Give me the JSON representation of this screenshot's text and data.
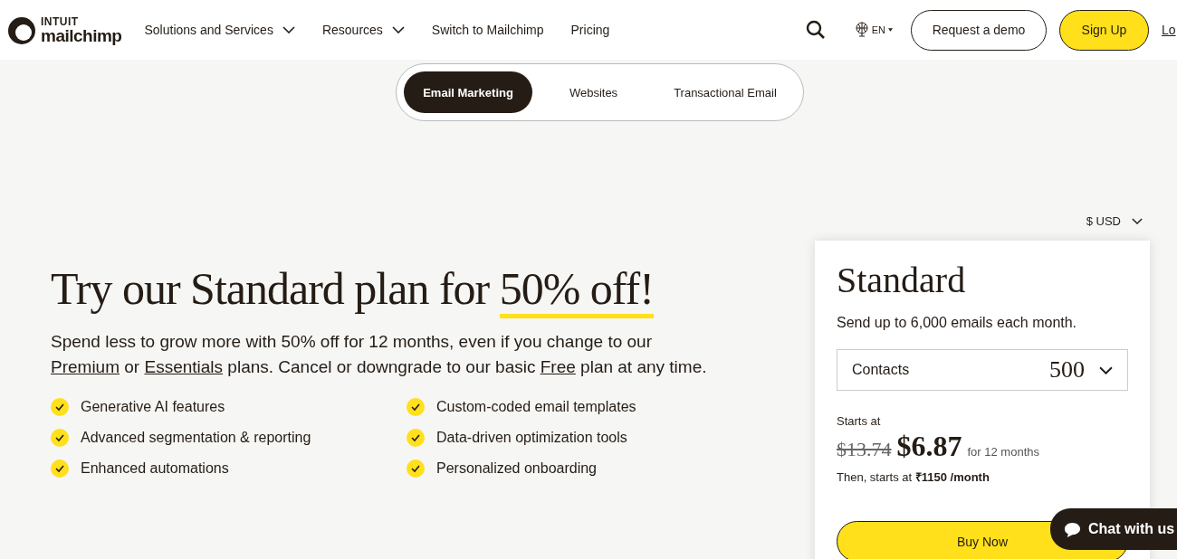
{
  "header": {
    "logo": {
      "top": "INTUIT",
      "bottom": "mailchimp"
    },
    "nav": [
      {
        "label": "Solutions and Services",
        "dropdown": true
      },
      {
        "label": "Resources",
        "dropdown": true
      },
      {
        "label": "Switch to Mailchimp",
        "dropdown": false
      },
      {
        "label": "Pricing",
        "dropdown": false
      }
    ],
    "language": "EN",
    "demo_button": "Request a demo",
    "signup_button": "Sign Up",
    "login_link": "Lo"
  },
  "tabs": [
    {
      "label": "Email Marketing",
      "selected": true
    },
    {
      "label": "Websites",
      "selected": false
    },
    {
      "label": "Transactional Email",
      "selected": false
    }
  ],
  "currency": "$ USD",
  "hero": {
    "title_start": "Try our Standard plan for ",
    "title_highlight": "50% off!",
    "paragraph": [
      {
        "kind": "text",
        "text": "Spend less to grow more with 50% off for 12 months, even if you change to our "
      },
      {
        "kind": "link",
        "text": "Premium"
      },
      {
        "kind": "text",
        "text": " or "
      },
      {
        "kind": "link",
        "text": "Essentials"
      },
      {
        "kind": "text",
        "text": " plans. Cancel or downgrade to our basic "
      },
      {
        "kind": "link",
        "text": "Free"
      },
      {
        "kind": "text",
        "text": " plan at any time."
      }
    ],
    "features": [
      "Generative AI features",
      "Custom-coded email templates",
      "Advanced segmentation & reporting",
      "Data-driven optimization tools",
      "Enhanced automations",
      "Personalized onboarding"
    ]
  },
  "plan_card": {
    "name": "Standard",
    "description": "Send up to 6,000 emails each month.",
    "contacts_label": "Contacts",
    "contacts_value": "500",
    "starts_at": "Starts at",
    "old_price": "$13.74",
    "price": "$6.87",
    "price_period": "for 12 months",
    "then_text": "Then, starts at ",
    "then_price": "₹1150 /month",
    "buy_button": "Buy Now"
  },
  "chat": "Chat with us"
}
